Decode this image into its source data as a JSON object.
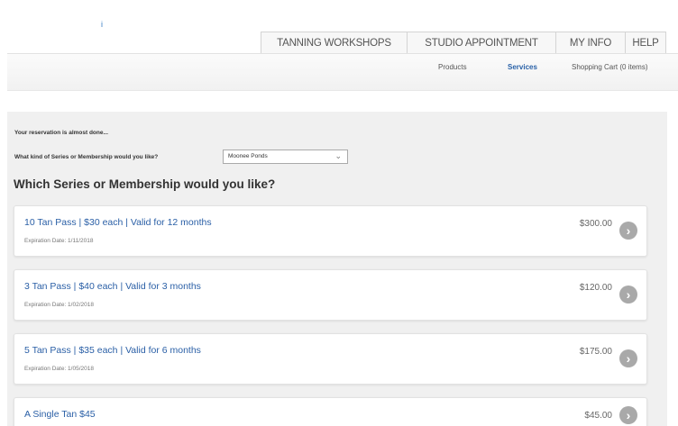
{
  "header": {
    "logo_glyph": "i"
  },
  "top_nav": [
    {
      "label": "TANNING WORKSHOPS"
    },
    {
      "label": "STUDIO APPOINTMENT"
    },
    {
      "label": "MY INFO"
    },
    {
      "label": "HELP"
    }
  ],
  "sub_nav": {
    "products": "Products",
    "services": "Services",
    "cart": "Shopping Cart (0 items)"
  },
  "main": {
    "notice": "Your reservation is almost done...",
    "question": "What kind of Series or Membership would you like?",
    "location_value": "Moonee Ponds",
    "section_title": "Which Series or Membership would you like?",
    "passes": [
      {
        "title": "10 Tan Pass | $30 each | Valid for 12 months",
        "expiry": "Expiration Date: 1/11/2018",
        "price": "$300.00"
      },
      {
        "title": "3 Tan Pass | $40 each | Valid for 3 months",
        "expiry": "Expiration Date: 1/02/2018",
        "price": "$120.00"
      },
      {
        "title": "5 Tan Pass | $35 each | Valid for 6 months",
        "expiry": "Expiration Date: 1/05/2018",
        "price": "$175.00"
      },
      {
        "title": "A Single Tan $45",
        "price": "$45.00"
      }
    ]
  },
  "icons": {
    "arrow": "›",
    "chevron": "⌄"
  },
  "colors": {
    "link": "#2a5fa6",
    "arrow_bg": "#a9a9a9",
    "panel_bg": "#f0f0f0"
  }
}
